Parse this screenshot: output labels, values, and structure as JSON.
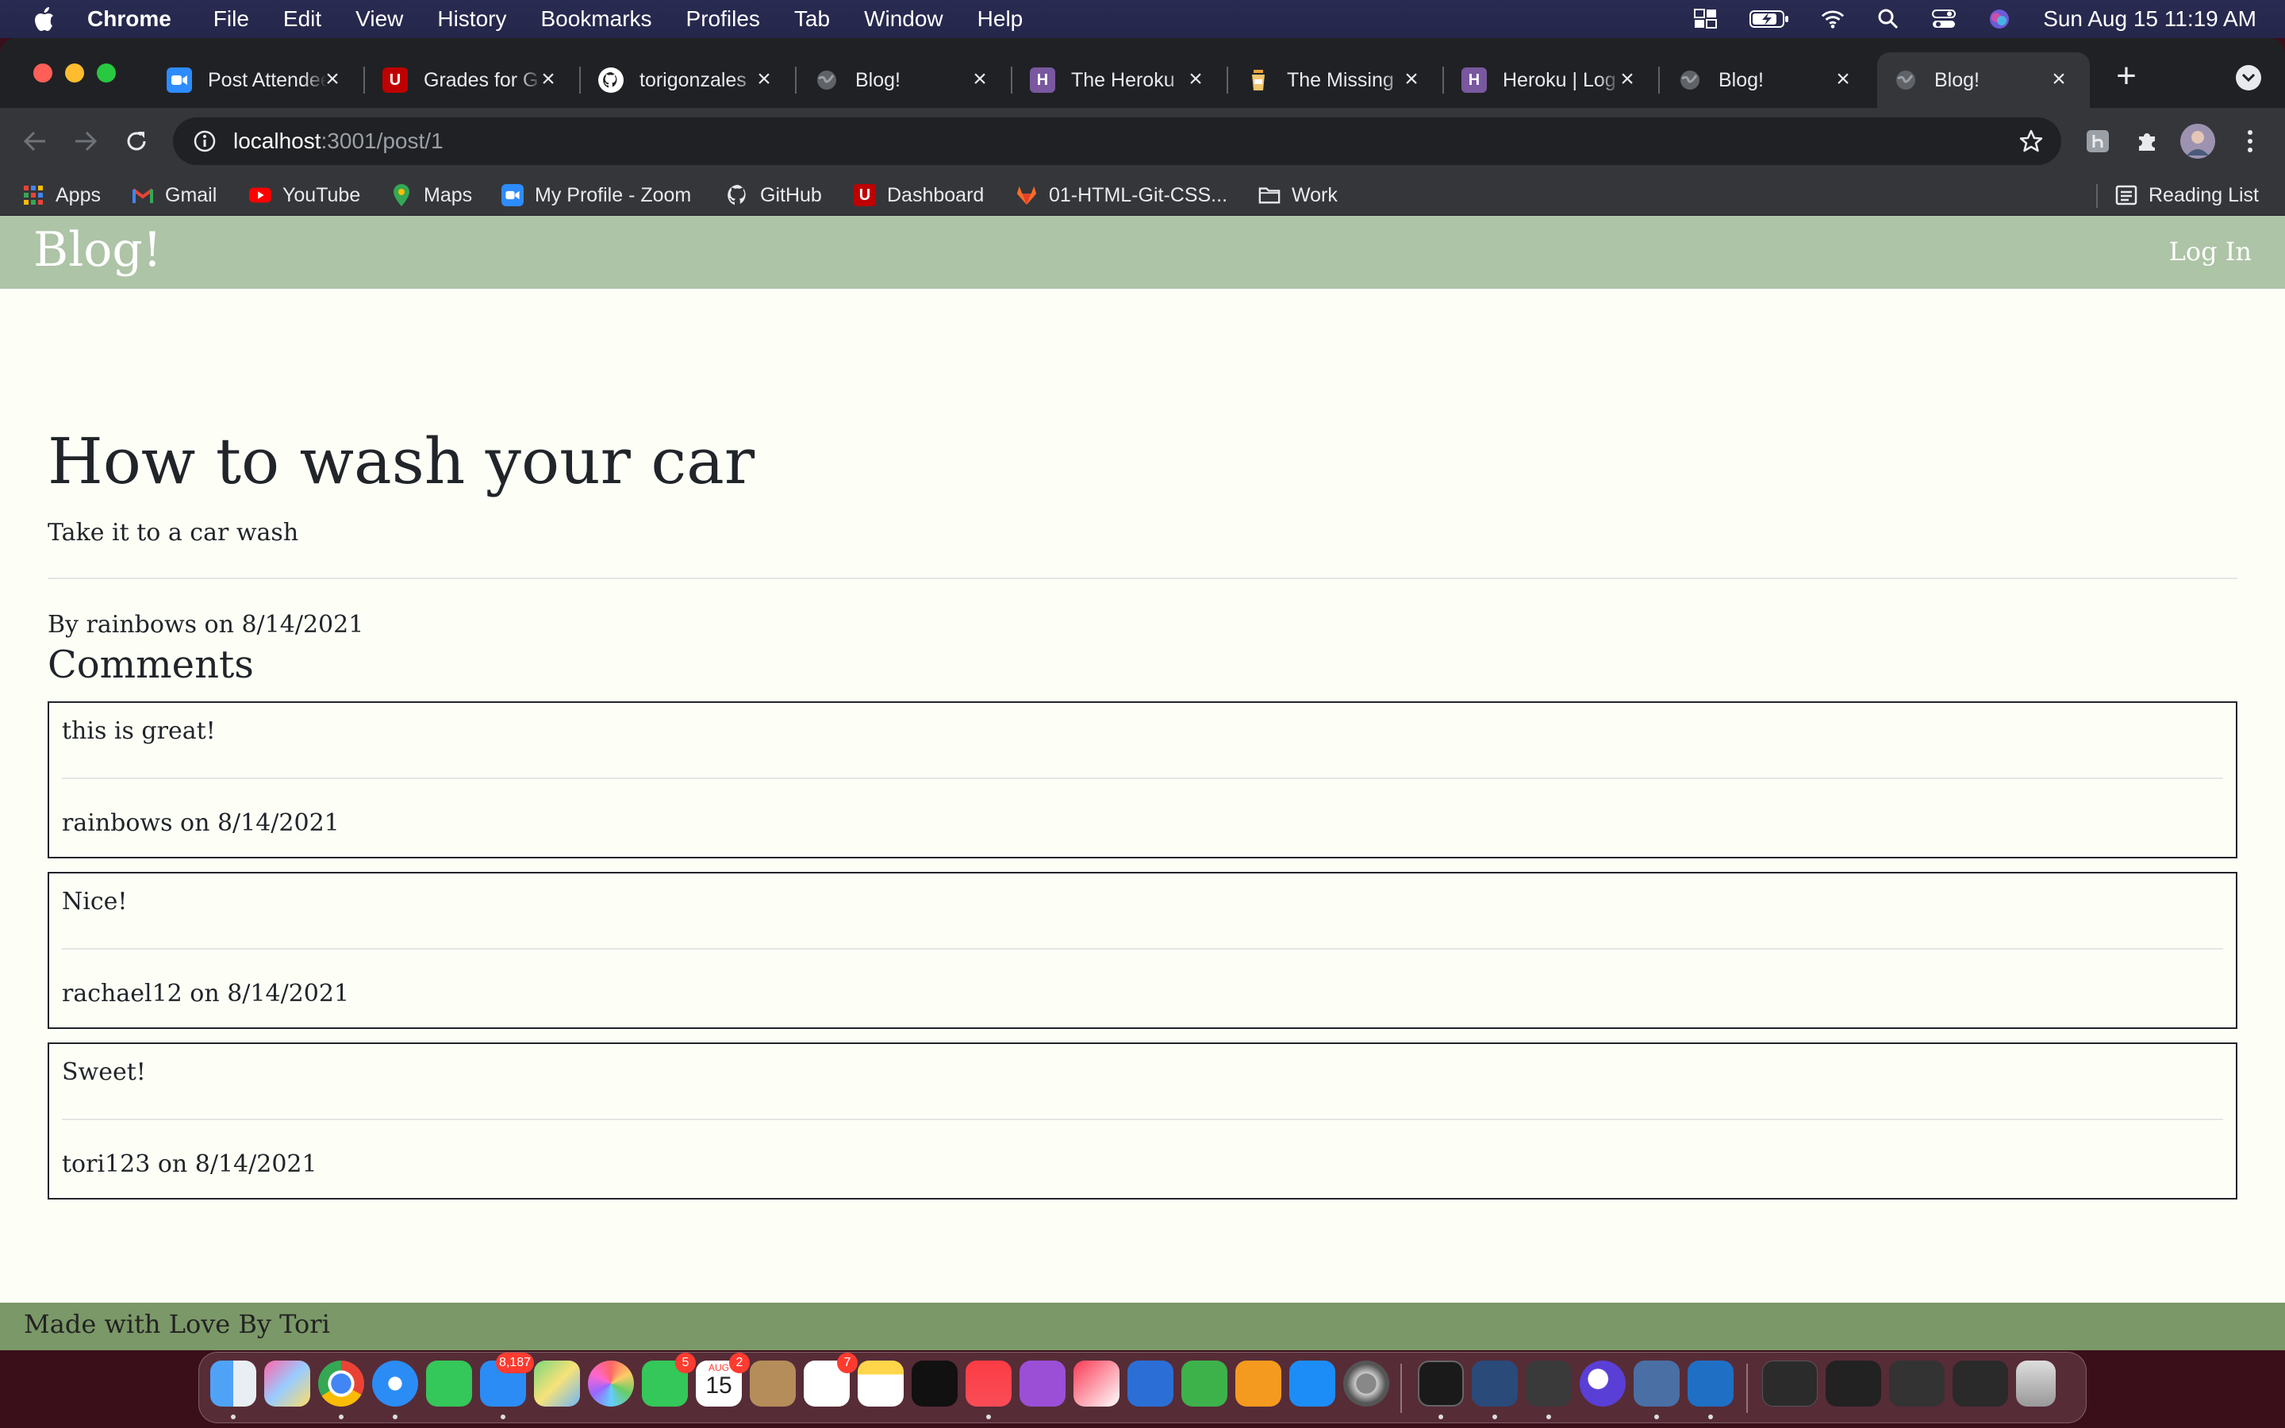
{
  "menubar": {
    "app_name": "Chrome",
    "items": [
      "File",
      "Edit",
      "View",
      "History",
      "Bookmarks",
      "Profiles",
      "Tab",
      "Window",
      "Help"
    ],
    "clock": "Sun Aug 15  11:19 AM"
  },
  "tabs": [
    {
      "title": "Post Attendee",
      "favicon": "zoom-icon",
      "color": "#2d8cff"
    },
    {
      "title": "Grades for G",
      "favicon": "utah-u-icon",
      "color": "#be0000"
    },
    {
      "title": "torigonzales",
      "favicon": "github-icon",
      "color": "#ffffff"
    },
    {
      "title": "Blog!",
      "favicon": "globe-icon",
      "color": "#5f6368"
    },
    {
      "title": "The Heroku",
      "favicon": "heroku-icon",
      "color": "#79589f"
    },
    {
      "title": "The Missing",
      "favicon": "missing-semester-icon",
      "color": "#e8a33d"
    },
    {
      "title": "Heroku | Log",
      "favicon": "heroku-icon",
      "color": "#79589f"
    },
    {
      "title": "Blog!",
      "favicon": "globe-icon",
      "color": "#5f6368"
    },
    {
      "title": "Blog!",
      "favicon": "globe-icon",
      "color": "#5f6368",
      "active": true
    }
  ],
  "address_bar": {
    "host": "localhost",
    "path": ":3001/post/1"
  },
  "bookmarks": [
    {
      "label": "Apps",
      "icon": "apps-grid-icon"
    },
    {
      "label": "Gmail",
      "icon": "gmail-icon"
    },
    {
      "label": "YouTube",
      "icon": "youtube-icon"
    },
    {
      "label": "Maps",
      "icon": "maps-icon"
    },
    {
      "label": "My Profile - Zoom",
      "icon": "zoom-icon"
    },
    {
      "label": "GitHub",
      "icon": "github-icon"
    },
    {
      "label": "Dashboard",
      "icon": "utah-u-icon"
    },
    {
      "label": "01-HTML-Git-CSS...",
      "icon": "gitlab-icon"
    },
    {
      "label": "Work",
      "icon": "folder-icon"
    }
  ],
  "reading_list": "Reading List",
  "page": {
    "brand": "Blog!",
    "login": "Log In",
    "post": {
      "title": "How to wash your car",
      "body": "Take it to a car wash",
      "meta": "By rainbows on 8/14/2021"
    },
    "comments_heading": "Comments",
    "comments": [
      {
        "text": "this is great!",
        "meta": "rainbows on 8/14/2021"
      },
      {
        "text": "Nice!",
        "meta": "rachael12 on 8/14/2021"
      },
      {
        "text": "Sweet!",
        "meta": "tori123 on 8/14/2021"
      }
    ],
    "footer": "Made with Love By Tori"
  },
  "dock": {
    "badges": {
      "mail": "8,187",
      "facetime": "5",
      "calendar": "2",
      "reminders": "7"
    },
    "calendar_month": "AUG",
    "calendar_day": "15"
  },
  "colors": {
    "header_bg": "#adc4a6",
    "footer_bg": "#7b9868",
    "page_bg": "#fdfff7"
  }
}
